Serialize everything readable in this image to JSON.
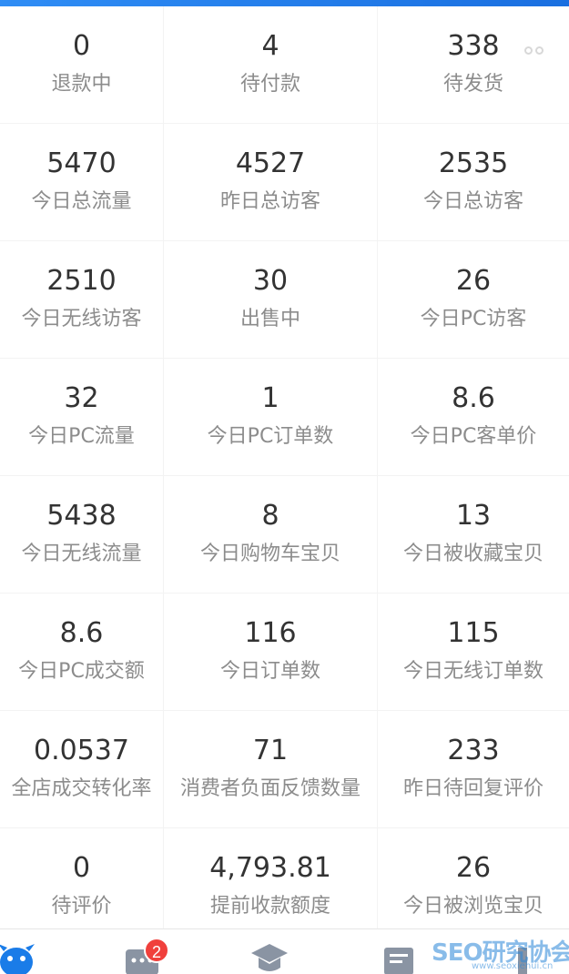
{
  "metrics": [
    {
      "value": "0",
      "label": "退款中"
    },
    {
      "value": "4",
      "label": "待付款"
    },
    {
      "value": "338",
      "label": "待发货"
    },
    {
      "value": "5470",
      "label": "今日总流量"
    },
    {
      "value": "4527",
      "label": "昨日总访客"
    },
    {
      "value": "2535",
      "label": "今日总访客"
    },
    {
      "value": "2510",
      "label": "今日无线访客"
    },
    {
      "value": "30",
      "label": "出售中"
    },
    {
      "value": "26",
      "label": "今日PC访客"
    },
    {
      "value": "32",
      "label": "今日PC流量"
    },
    {
      "value": "1",
      "label": "今日PC订单数"
    },
    {
      "value": "8.6",
      "label": "今日PC客单价"
    },
    {
      "value": "5438",
      "label": "今日无线流量"
    },
    {
      "value": "8",
      "label": "今日购物车宝贝"
    },
    {
      "value": "13",
      "label": "今日被收藏宝贝"
    },
    {
      "value": "8.6",
      "label": "今日PC成交额"
    },
    {
      "value": "116",
      "label": "今日订单数"
    },
    {
      "value": "115",
      "label": "今日无线订单数"
    },
    {
      "value": "0.0537",
      "label": "全店成交转化率"
    },
    {
      "value": "71",
      "label": "消费者负面反馈数量"
    },
    {
      "value": "233",
      "label": "昨日待回复评价"
    },
    {
      "value": "0",
      "label": "待评价"
    },
    {
      "value": "4,793.81",
      "label": "提前收款额度"
    },
    {
      "value": "26",
      "label": "今日被浏览宝贝"
    }
  ],
  "tabbar": {
    "message_badge": "2",
    "tabs": [
      {
        "icon": "mascot-icon"
      },
      {
        "icon": "message-icon"
      },
      {
        "icon": "graduation-cap-icon"
      },
      {
        "icon": "document-icon"
      },
      {
        "icon": "more-icon"
      }
    ]
  },
  "watermark": {
    "text": "SEO研究协会网",
    "sub": "www.seoxiehui.cn"
  },
  "colors": {
    "accent": "#1a7ce8",
    "badge": "#f0403c",
    "value_text": "#333333",
    "label_text": "#8c8c8c"
  }
}
